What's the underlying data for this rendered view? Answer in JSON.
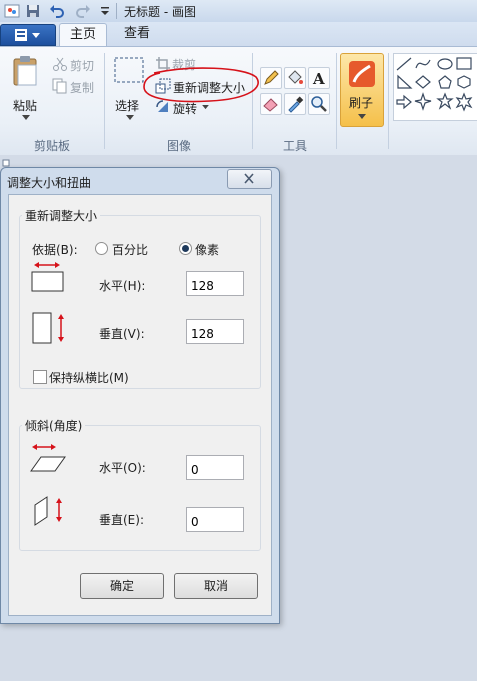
{
  "window": {
    "title": "无标题 - 画图"
  },
  "ribbon": {
    "tabs": [
      "主页",
      "查看"
    ],
    "clipboard": {
      "paste": "粘贴",
      "cut": "剪切",
      "copy": "复制",
      "group": "剪贴板"
    },
    "image": {
      "select": "选择",
      "crop": "裁剪",
      "resize": "重新调整大小",
      "rotate": "旋转",
      "group": "图像"
    },
    "tools": {
      "group": "工具"
    },
    "brushes": {
      "label": "刷子"
    }
  },
  "dialog": {
    "title": "调整大小和扭曲",
    "resize": {
      "group": "重新调整大小",
      "by_label": "依据(B):",
      "percent": "百分比",
      "pixels": "像素",
      "selected": "pixels",
      "horizontal_label": "水平(H):",
      "horizontal_value": "128",
      "vertical_label": "垂直(V):",
      "vertical_value": "128",
      "keep_ratio": "保持纵横比(M)",
      "keep_ratio_checked": false
    },
    "skew": {
      "group": "倾斜(角度)",
      "horizontal_label": "水平(O):",
      "horizontal_value": "0",
      "vertical_label": "垂直(E):",
      "vertical_value": "0"
    },
    "ok": "确定",
    "cancel": "取消"
  },
  "colors": {
    "annotation": "#d6121a",
    "ribbon_accent": "#f5a623"
  }
}
